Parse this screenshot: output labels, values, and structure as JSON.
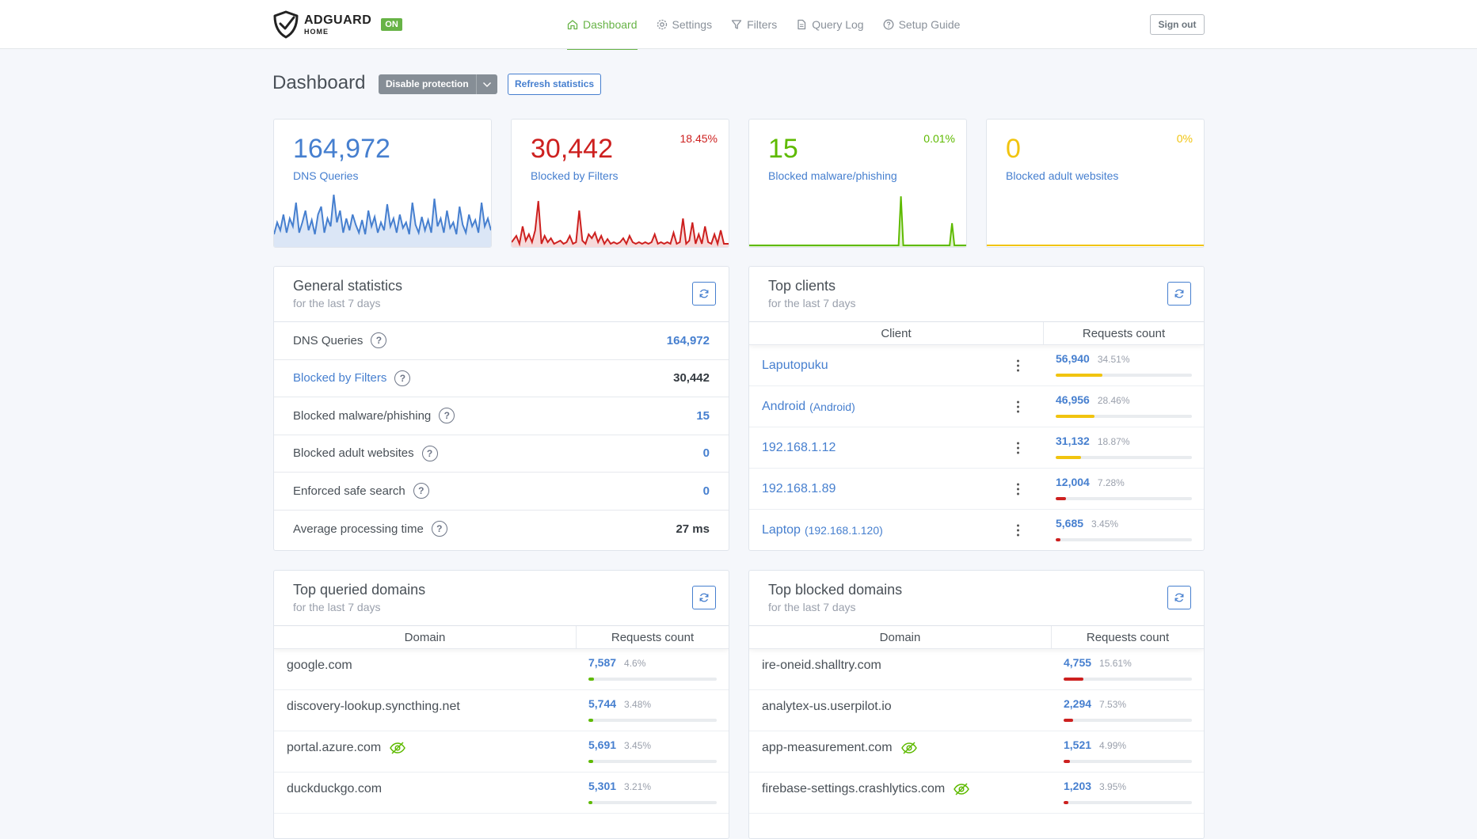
{
  "header": {
    "logo_name": "ADGUARD",
    "logo_sub": "HOME",
    "on_badge": "ON",
    "nav": [
      {
        "label": "Dashboard",
        "icon": "home-icon",
        "active": true
      },
      {
        "label": "Settings",
        "icon": "gear-icon",
        "active": false
      },
      {
        "label": "Filters",
        "icon": "filter-icon",
        "active": false
      },
      {
        "label": "Query Log",
        "icon": "document-icon",
        "active": false
      },
      {
        "label": "Setup Guide",
        "icon": "help-circle-icon",
        "active": false
      }
    ],
    "sign_out": "Sign out"
  },
  "page": {
    "title": "Dashboard",
    "disable_protection": "Disable protection",
    "refresh_statistics": "Refresh statistics"
  },
  "stats": [
    {
      "value": "164,972",
      "label": "DNS Queries",
      "percent": "",
      "color": "#467fcf"
    },
    {
      "value": "30,442",
      "label": "Blocked by Filters",
      "percent": "18.45%",
      "color": "#cd201f"
    },
    {
      "value": "15",
      "label": "Blocked malware/phishing",
      "percent": "0.01%",
      "color": "#5eba00"
    },
    {
      "value": "0",
      "label": "Blocked adult websites",
      "percent": "0%",
      "color": "#f1c40f"
    }
  ],
  "general": {
    "title": "General statistics",
    "subtitle": "for the last 7 days",
    "rows": [
      {
        "label": "DNS Queries",
        "value": "164,972"
      },
      {
        "label": "Blocked by Filters",
        "value": "30,442"
      },
      {
        "label": "Blocked malware/phishing",
        "value": "15"
      },
      {
        "label": "Blocked adult websites",
        "value": "0"
      },
      {
        "label": "Enforced safe search",
        "value": "0"
      },
      {
        "label": "Average processing time",
        "value": "27 ms"
      }
    ]
  },
  "clients": {
    "title": "Top clients",
    "subtitle": "for the last 7 days",
    "col_client": "Client",
    "col_count": "Requests count",
    "rows": [
      {
        "name": "Laputopuku",
        "extra": "",
        "count": "56,940",
        "pct": "34.51%",
        "fill": 0.3451,
        "color": "#f1c40f"
      },
      {
        "name": "Android",
        "extra": "(Android)",
        "count": "46,956",
        "pct": "28.46%",
        "fill": 0.2846,
        "color": "#f1c40f"
      },
      {
        "name": "192.168.1.12",
        "extra": "",
        "count": "31,132",
        "pct": "18.87%",
        "fill": 0.1887,
        "color": "#f1c40f"
      },
      {
        "name": "192.168.1.89",
        "extra": "",
        "count": "12,004",
        "pct": "7.28%",
        "fill": 0.0728,
        "color": "#cd201f"
      },
      {
        "name": "Laptop",
        "extra": "(192.168.1.120)",
        "count": "5,685",
        "pct": "3.45%",
        "fill": 0.0345,
        "color": "#cd201f"
      }
    ]
  },
  "queried": {
    "title": "Top queried domains",
    "subtitle": "for the last 7 days",
    "col_domain": "Domain",
    "col_count": "Requests count",
    "rows": [
      {
        "domain": "google.com",
        "tracker": false,
        "count": "7,587",
        "pct": "4.6%",
        "fill": 0.046
      },
      {
        "domain": "discovery-lookup.syncthing.net",
        "tracker": false,
        "count": "5,744",
        "pct": "3.48%",
        "fill": 0.0348
      },
      {
        "domain": "portal.azure.com",
        "tracker": true,
        "count": "5,691",
        "pct": "3.45%",
        "fill": 0.0345
      },
      {
        "domain": "duckduckgo.com",
        "tracker": false,
        "count": "5,301",
        "pct": "3.21%",
        "fill": 0.0321
      }
    ]
  },
  "blocked": {
    "title": "Top blocked domains",
    "subtitle": "for the last 7 days",
    "col_domain": "Domain",
    "col_count": "Requests count",
    "rows": [
      {
        "domain": "ire-oneid.shalltry.com",
        "tracker": false,
        "count": "4,755",
        "pct": "15.61%",
        "fill": 0.1561
      },
      {
        "domain": "analytex-us.userpilot.io",
        "tracker": false,
        "count": "2,294",
        "pct": "7.53%",
        "fill": 0.0753
      },
      {
        "domain": "app-measurement.com",
        "tracker": true,
        "count": "1,521",
        "pct": "4.99%",
        "fill": 0.0499
      },
      {
        "domain": "firebase-settings.crashlytics.com",
        "tracker": true,
        "count": "1,203",
        "pct": "3.95%",
        "fill": 0.0395
      }
    ]
  }
}
